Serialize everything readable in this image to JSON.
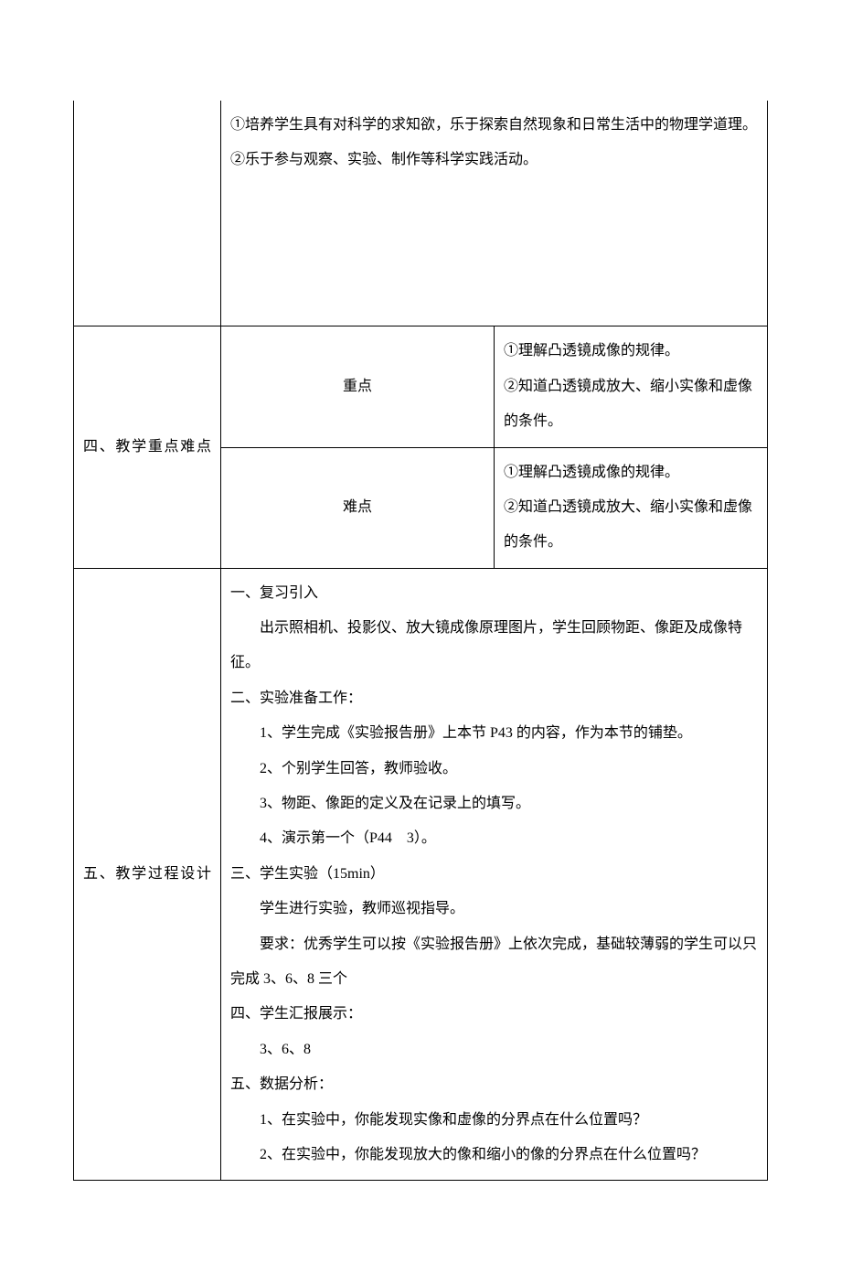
{
  "row1": {
    "line1": "①培养学生具有对科学的求知欲，乐于探索自然现象和日常生活中的物理学道理。",
    "line2": "②乐于参与观察、实验、制作等科学实践活动。"
  },
  "row2": {
    "label": "四、教学重点难点",
    "sub1_label": "重点",
    "sub1_line1": "①理解凸透镜成像的规律。",
    "sub1_line2": "②知道凸透镜成放大、缩小实像和虚像的条件。",
    "sub2_label": "难点",
    "sub2_line1": "①理解凸透镜成像的规律。",
    "sub2_line2": "②知道凸透镜成放大、缩小实像和虚像的条件。"
  },
  "row3": {
    "label": "五、教学过程设计",
    "s1_head": "一、复习引入",
    "s1_body": "出示照相机、投影仪、放大镜成像原理图片，学生回顾物距、像距及成像特征。",
    "s2_head": "二、实验准备工作：",
    "s2_1": "1、学生完成《实验报告册》上本节 P43 的内容，作为本节的铺垫。",
    "s2_2": "2、个别学生回答，教师验收。",
    "s2_3": "3、物距、像距的定义及在记录上的填写。",
    "s2_4": "4、演示第一个（P44　3）。",
    "s3_head": "三、学生实验（15min）",
    "s3_1": "学生进行实验，教师巡视指导。",
    "s3_2": "要求：优秀学生可以按《实验报告册》上依次完成，基础较薄弱的学生可以只完成 3、6、8 三个",
    "s4_head": "四、学生汇报展示：",
    "s4_1": "3、6、8",
    "s5_head": "五、数据分析：",
    "s5_1": "1、在实验中，你能发现实像和虚像的分界点在什么位置吗？",
    "s5_2": "2、在实验中，你能发现放大的像和缩小的像的分界点在什么位置吗？"
  }
}
